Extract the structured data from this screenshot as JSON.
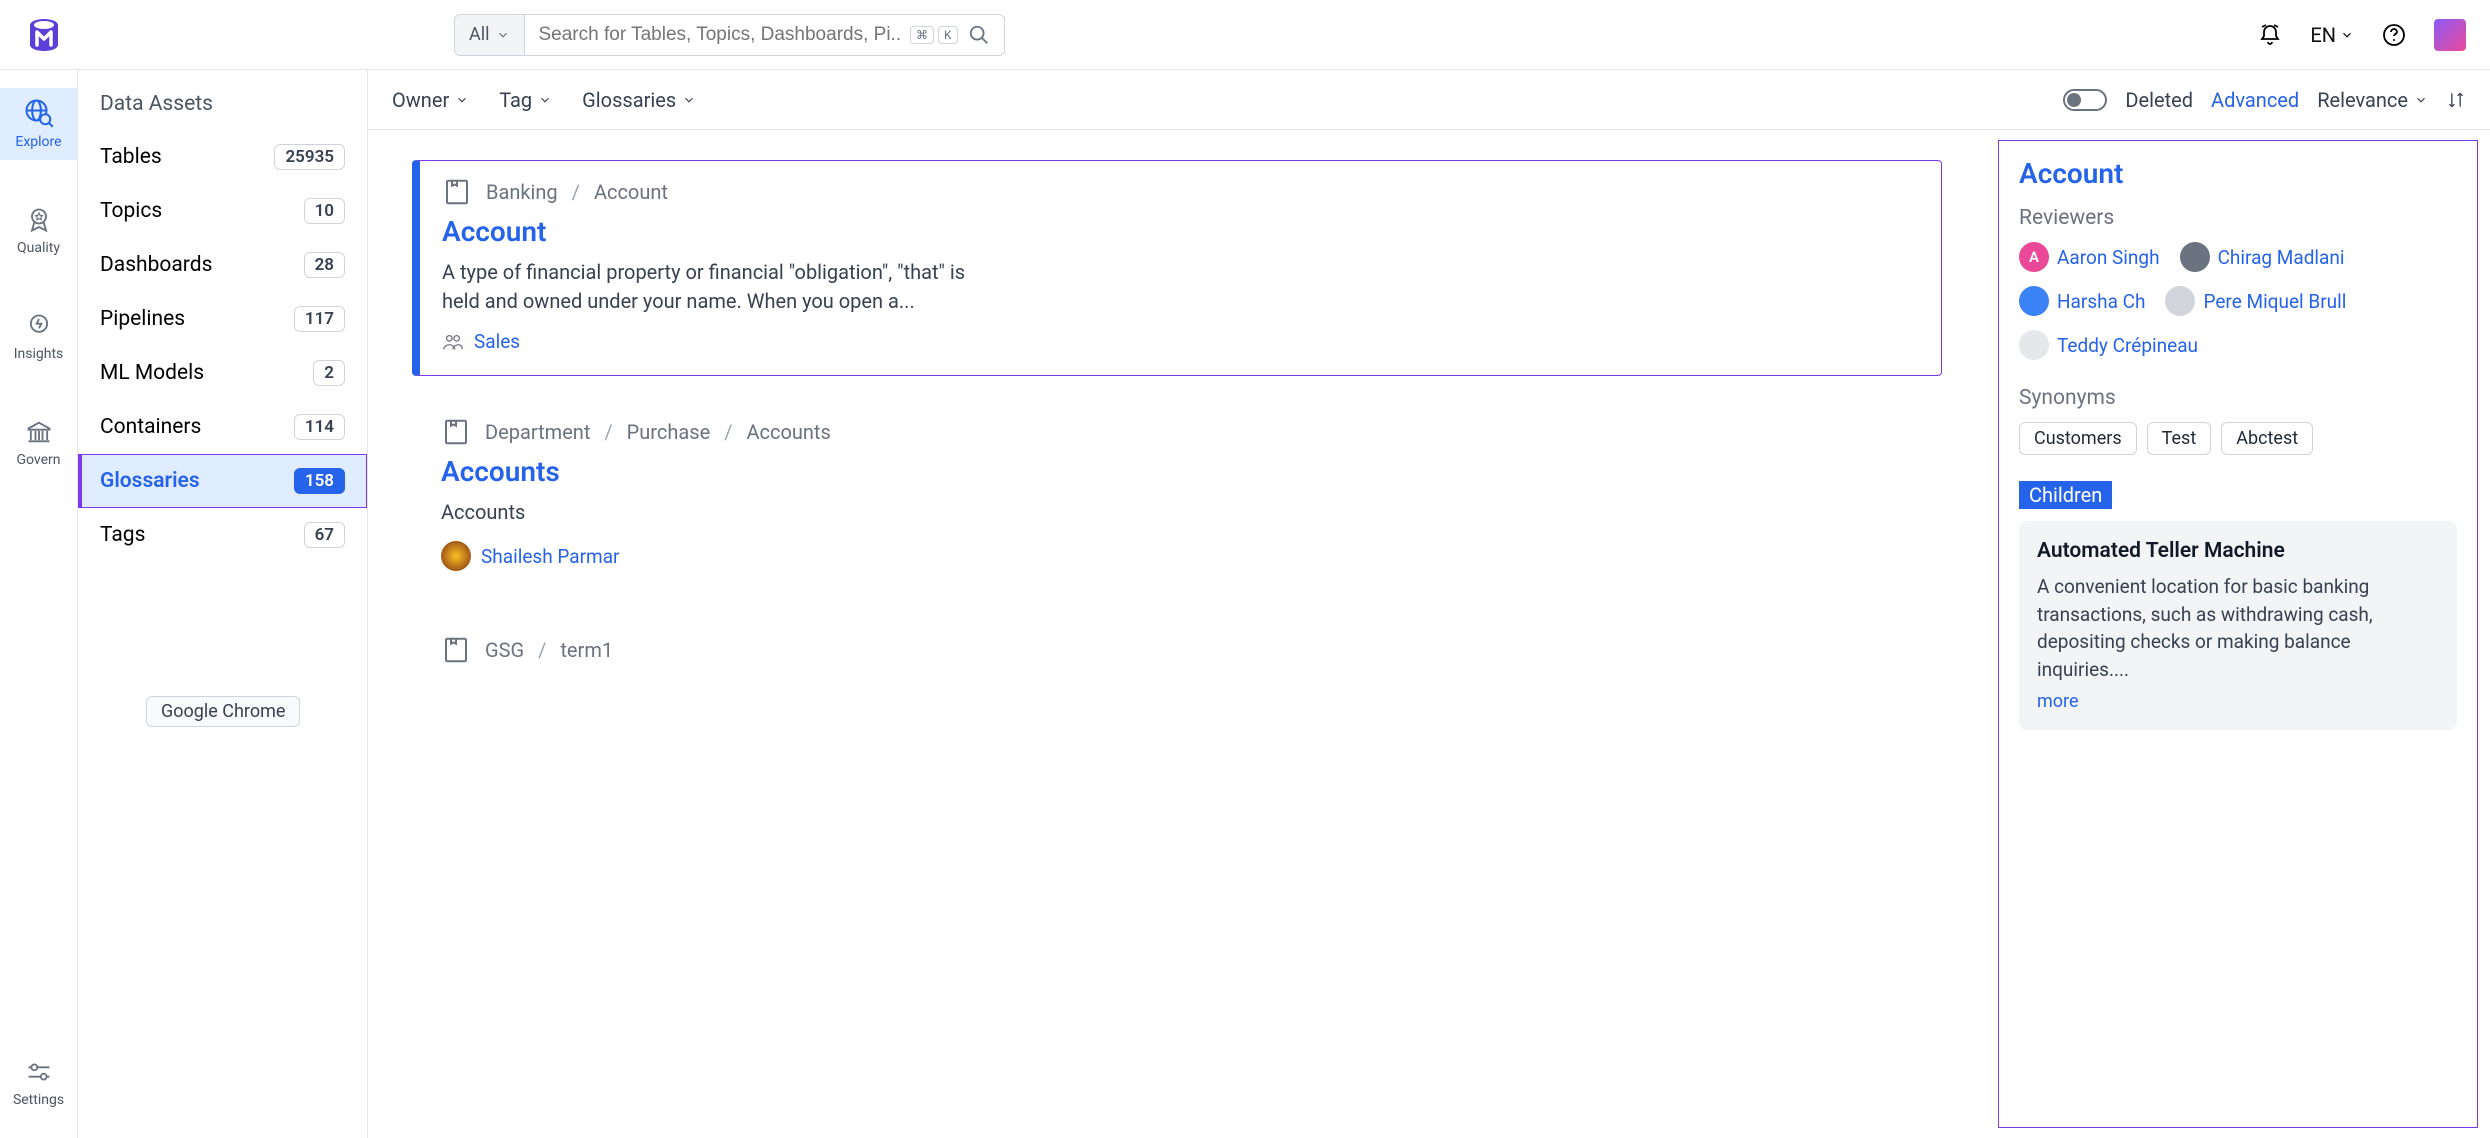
{
  "header": {
    "search_scope": "All",
    "search_placeholder": "Search for Tables, Topics, Dashboards, Pi...",
    "kbd1": "⌘",
    "kbd2": "K",
    "lang": "EN"
  },
  "rail": {
    "items": [
      {
        "label": "Explore",
        "icon": "globe-search-icon",
        "active": true
      },
      {
        "label": "Quality",
        "icon": "ribbon-icon",
        "active": false
      },
      {
        "label": "Insights",
        "icon": "bulb-icon",
        "active": false
      },
      {
        "label": "Govern",
        "icon": "building-icon",
        "active": false
      }
    ],
    "bottom": {
      "label": "Settings",
      "icon": "sliders-icon"
    }
  },
  "sidebar": {
    "title": "Data Assets",
    "items": [
      {
        "label": "Tables",
        "count": "25935",
        "active": false
      },
      {
        "label": "Topics",
        "count": "10",
        "active": false
      },
      {
        "label": "Dashboards",
        "count": "28",
        "active": false
      },
      {
        "label": "Pipelines",
        "count": "117",
        "active": false
      },
      {
        "label": "ML Models",
        "count": "2",
        "active": false
      },
      {
        "label": "Containers",
        "count": "114",
        "active": false
      },
      {
        "label": "Glossaries",
        "count": "158",
        "active": true
      },
      {
        "label": "Tags",
        "count": "67",
        "active": false
      }
    ],
    "chrome_pill": "Google Chrome"
  },
  "filterbar": {
    "owner": "Owner",
    "tag": "Tag",
    "glossaries": "Glossaries",
    "deleted": "Deleted",
    "advanced": "Advanced",
    "relevance": "Relevance"
  },
  "results": [
    {
      "crumbs": [
        "Banking",
        "Account"
      ],
      "title": "Account",
      "desc": "A type of financial property or financial \"obligation\", \"that\" is held and owned under your name. When you open a...",
      "tag": "Sales",
      "selected": true
    },
    {
      "crumbs": [
        "Department",
        "Purchase",
        "Accounts"
      ],
      "title": "Accounts",
      "desc": "Accounts",
      "owner": "Shailesh Parmar",
      "selected": false
    },
    {
      "crumbs": [
        "GSG",
        "term1"
      ],
      "title": "",
      "desc": "",
      "selected": false,
      "partial": true
    }
  ],
  "details": {
    "title": "Account",
    "reviewers_label": "Reviewers",
    "reviewers": [
      {
        "name": "Aaron Singh",
        "initial": "A",
        "bg": "#ec4899",
        "fg": "#fff"
      },
      {
        "name": "Chirag Madlani",
        "initial": "",
        "bg": "#6b7280"
      },
      {
        "name": "Harsha Ch",
        "initial": "",
        "bg": "#3b82f6"
      },
      {
        "name": "Pere Miquel Brull",
        "initial": "",
        "bg": "#d1d5db"
      },
      {
        "name": "Teddy Crépineau",
        "initial": "",
        "bg": "#e5e7eb"
      }
    ],
    "synonyms_label": "Synonyms",
    "synonyms": [
      "Customers",
      "Test",
      "Abctest"
    ],
    "children_label": "Children",
    "child": {
      "title": "Automated Teller Machine",
      "desc": "A convenient location for basic banking transactions, such as withdrawing cash, depositing checks or making balance inquiries....",
      "more": "more"
    }
  }
}
